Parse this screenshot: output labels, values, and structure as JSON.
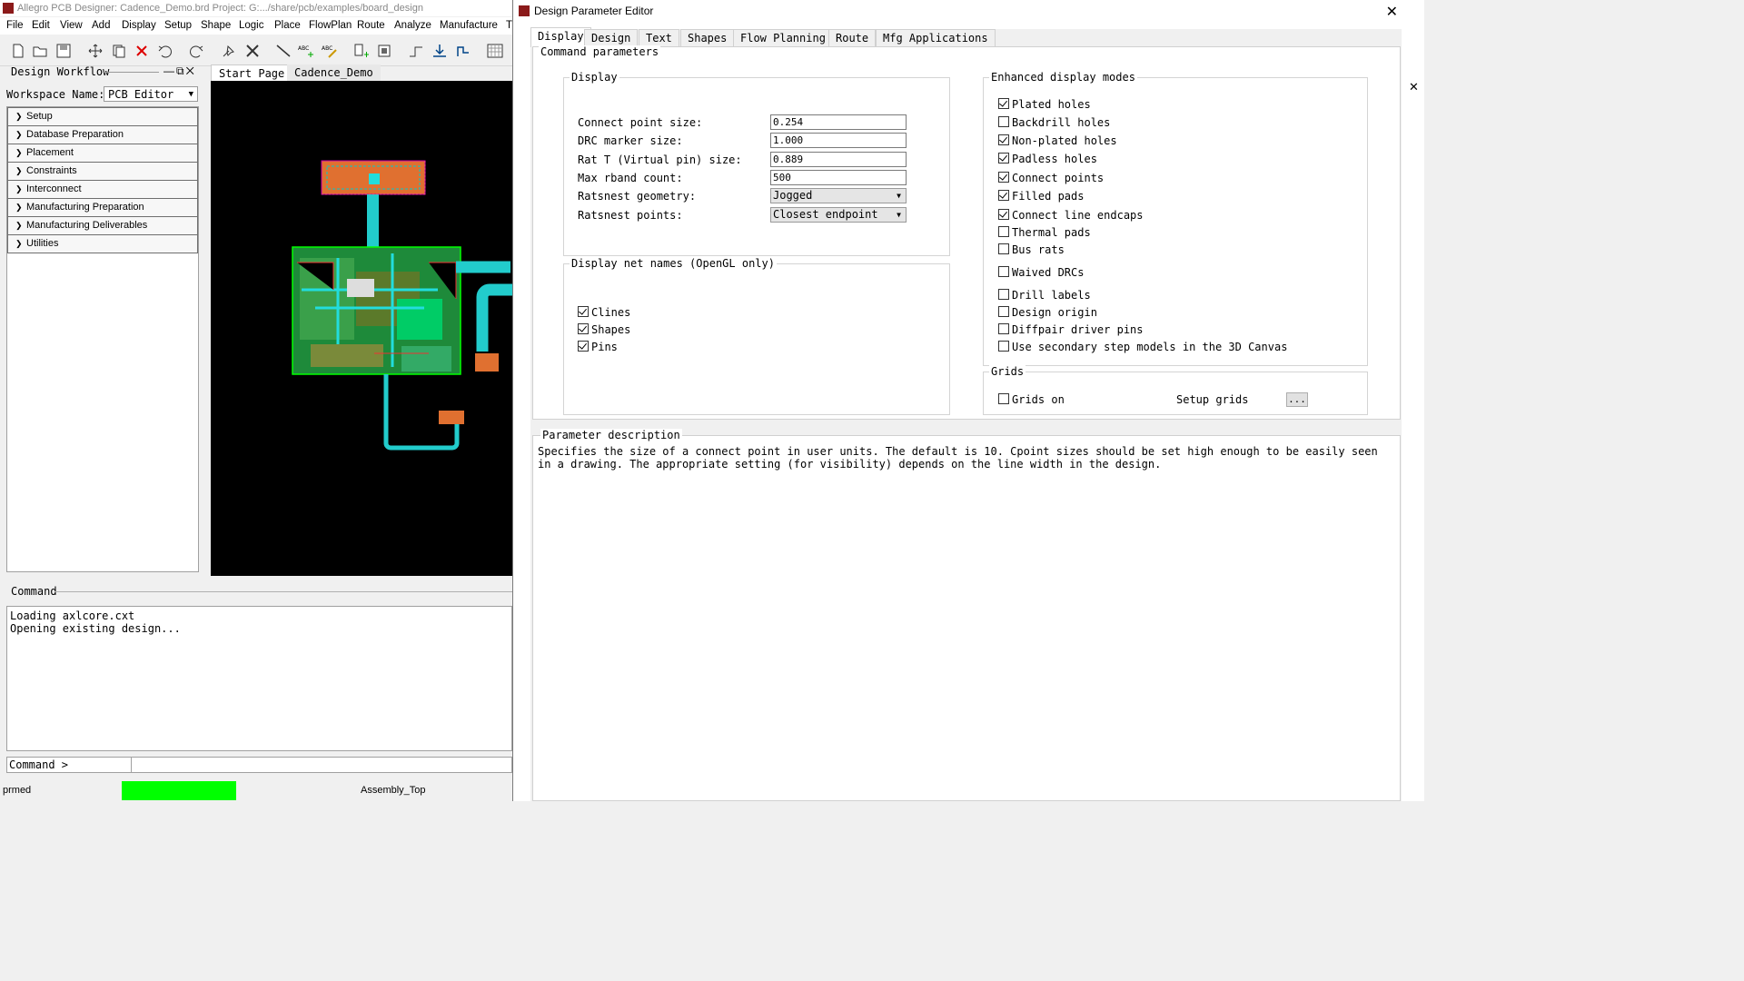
{
  "app": {
    "title": "Allegro PCB Designer: Cadence_Demo.brd  Project: G:.../share/pcb/examples/board_design",
    "menus": [
      "File",
      "Edit",
      "View",
      "Add",
      "Display",
      "Setup",
      "Shape",
      "Logic",
      "Place",
      "FlowPlan",
      "Route",
      "Analyze",
      "Manufacture",
      "T"
    ]
  },
  "toolbar_icons": [
    "new-file-icon",
    "open-folder-icon",
    "save-icon",
    "move-icon",
    "copy-icon",
    "delete-icon",
    "undo-icon",
    "redo-icon",
    "pin-icon",
    "cut-icon",
    "add-line-icon",
    "add-text-icon",
    "edit-text-icon",
    "place-component-icon",
    "component-icon",
    "connect-icon",
    "route-icon",
    "slide-icon",
    "grid-icon"
  ],
  "workflow": {
    "title": "Design Workflow",
    "workspace_label": "Workspace Name:",
    "workspace_value": "PCB Editor",
    "items": [
      {
        "label": "Setup"
      },
      {
        "label": "Database Preparation"
      },
      {
        "label": "Placement"
      },
      {
        "label": "Constraints"
      },
      {
        "label": "Interconnect"
      },
      {
        "label": "Manufacturing Preparation"
      },
      {
        "label": "Manufacturing Deliverables"
      },
      {
        "label": "Utilities"
      }
    ]
  },
  "doc_tabs": {
    "start": "Start Page",
    "design": "Cadence_Demo"
  },
  "command": {
    "label": "Command",
    "output": "Loading axlcore.cxt\nOpening existing design...",
    "prompt": "Command >"
  },
  "status": {
    "mode": "prmed",
    "layer": "Assembly_Top",
    "indicator_color": "#00ff00"
  },
  "dialog": {
    "title": "Design Parameter Editor",
    "tabs": [
      "Display",
      "Design",
      "Text",
      "Shapes",
      "Flow Planning",
      "Route",
      "Mfg Applications"
    ],
    "active_tab": "Display",
    "cmd_params_title": "Command parameters",
    "display_group": {
      "title": "Display",
      "fields": [
        {
          "label": "Connect point size:",
          "value": "0.254",
          "kind": "input"
        },
        {
          "label": "DRC marker size:",
          "value": "1.000",
          "kind": "input"
        },
        {
          "label": "Rat T (Virtual pin) size:",
          "value": "0.889",
          "kind": "input"
        },
        {
          "label": "Max rband count:",
          "value": "500",
          "kind": "input"
        },
        {
          "label": "Ratsnest geometry:",
          "value": "Jogged",
          "kind": "select"
        },
        {
          "label": "Ratsnest points:",
          "value": "Closest endpoint",
          "kind": "select"
        }
      ]
    },
    "net_names_group": {
      "title": "Display net names (OpenGL only)",
      "items": [
        {
          "label": "Clines",
          "checked": true
        },
        {
          "label": "Shapes",
          "checked": true
        },
        {
          "label": "Pins",
          "checked": true
        }
      ]
    },
    "enhanced_group": {
      "title": "Enhanced display modes",
      "items": [
        {
          "label": "Plated holes",
          "checked": true
        },
        {
          "label": "Backdrill holes",
          "checked": false
        },
        {
          "label": "Non-plated holes",
          "checked": true
        },
        {
          "label": "Padless holes",
          "checked": true
        },
        {
          "label": "Connect points",
          "checked": true
        },
        {
          "label": "Filled pads",
          "checked": true
        },
        {
          "label": "Connect line endcaps",
          "checked": true
        },
        {
          "label": "Thermal pads",
          "checked": false
        },
        {
          "label": "Bus rats",
          "checked": false
        },
        {
          "label": "Waived DRCs",
          "checked": false
        },
        {
          "label": "Drill labels",
          "checked": false
        },
        {
          "label": "Design origin",
          "checked": false
        },
        {
          "label": "Diffpair driver pins",
          "checked": false
        },
        {
          "label": "Use secondary step models in the 3D Canvas",
          "checked": false
        }
      ]
    },
    "grids_group": {
      "title": "Grids",
      "grids_on": {
        "label": "Grids on",
        "checked": false
      },
      "setup_label": "Setup grids",
      "setup_button": "..."
    },
    "param_desc": {
      "title": "Parameter description",
      "text": "Specifies the size of a connect point in user units. The default is 10. Cpoint sizes should be set high enough to be easily seen in a drawing. The appropriate setting (for visibility) depends on the line width in the design."
    }
  }
}
